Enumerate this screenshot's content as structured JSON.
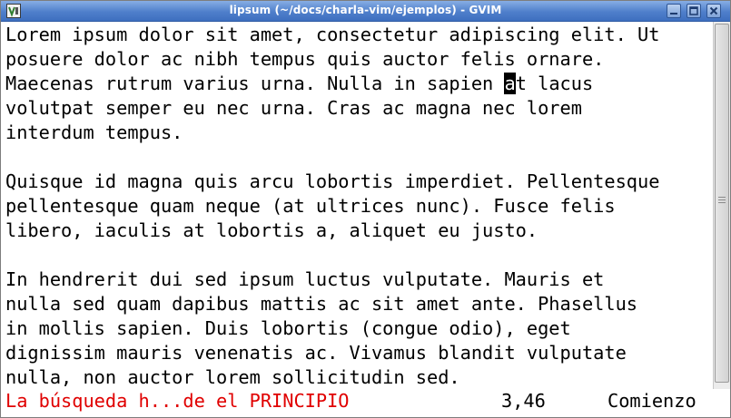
{
  "window": {
    "title": "lipsum (~/docs/charla-vim/ejemplos) - GVIM",
    "icon": "vim-icon"
  },
  "window_controls": {
    "minimize": "minimize-icon",
    "maximize": "maximize-icon",
    "close": "close-icon"
  },
  "editor": {
    "cursor": {
      "line": 3,
      "column": 46
    },
    "lines": [
      "Lorem ipsum dolor sit amet, consectetur adipiscing elit. Ut",
      "posuere dolor ac nibh tempus quis auctor felis ornare.",
      "Maecenas rutrum varius urna. Nulla in sapien at lacus",
      "volutpat semper eu nec urna. Cras ac magna nec lorem",
      "interdum tempus.",
      "",
      "Quisque id magna quis arcu lobortis imperdiet. Pellentesque",
      "pellentesque quam neque (at ultrices nunc). Fusce felis",
      "libero, iaculis at lobortis a, aliquet eu justo.",
      "",
      "In hendrerit dui sed ipsum luctus vulputate. Mauris et",
      "nulla sed quam dapibus mattis ac sit amet ante. Phasellus",
      "in mollis sapien. Duis lobortis (congue odio), eget",
      "dignissim mauris venenatis ac. Vivamus blandit vulputate",
      "nulla, non auctor lorem sollicitudin sed."
    ]
  },
  "command_line": {
    "message": "La búsqueda h...de el PRINCIPIO",
    "position": "3,46",
    "location": "Comienzo"
  },
  "colors": {
    "titlebar": "#4f7fcb",
    "message": "#e00000",
    "cursor": "#000000",
    "background": "#ffffff"
  }
}
